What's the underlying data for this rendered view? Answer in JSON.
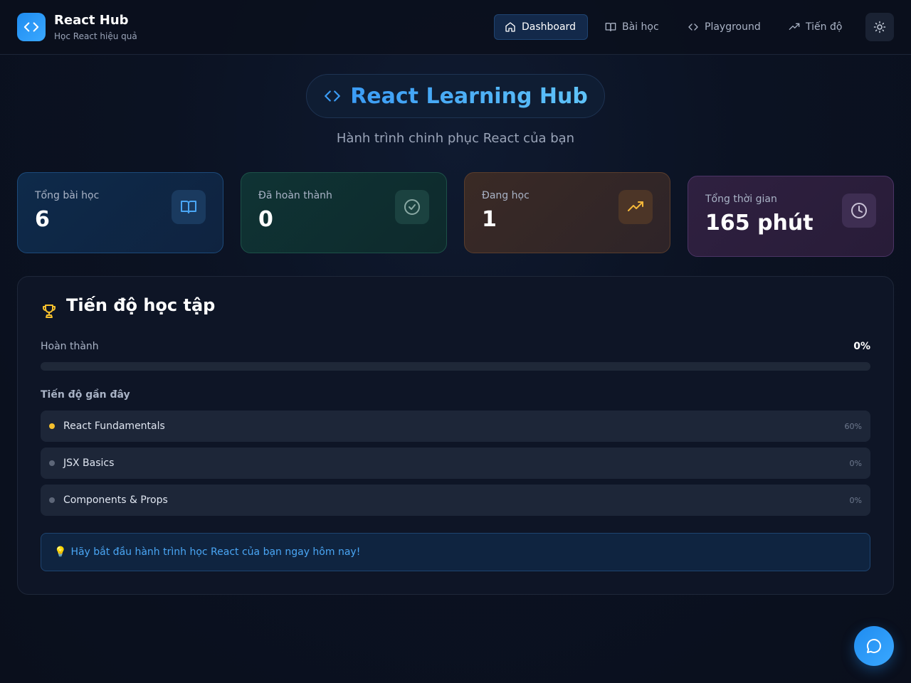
{
  "header": {
    "brand_title": "React Hub",
    "brand_subtitle": "Học React hiệu quả",
    "nav": [
      {
        "label": "Dashboard",
        "icon": "home-icon",
        "active": true
      },
      {
        "label": "Bài học",
        "icon": "book-icon",
        "active": false
      },
      {
        "label": "Playground",
        "icon": "code-icon",
        "active": false
      },
      {
        "label": "Tiến độ",
        "icon": "trending-up-icon",
        "active": false
      }
    ],
    "theme_icon": "sun-icon"
  },
  "hero": {
    "title": "React Learning Hub",
    "subtitle": "Hành trình chinh phục React của bạn"
  },
  "stats": [
    {
      "label": "Tổng bài học",
      "value": "6",
      "icon": "book-icon",
      "color": "#4aa6f4"
    },
    {
      "label": "Đã hoàn thành",
      "value": "0",
      "icon": "check-circle-icon",
      "color": "#8aa9a4"
    },
    {
      "label": "Đang học",
      "value": "1",
      "icon": "trending-up-icon",
      "color": "#f5b83a"
    },
    {
      "label": "Tổng thời gian",
      "value": "165 phút",
      "icon": "clock-icon",
      "color": "#c9c2d6"
    }
  ],
  "progress": {
    "title": "Tiến độ học tập",
    "complete_label": "Hoàn thành",
    "complete_percent": "0%",
    "complete_fraction": 0,
    "recent_title": "Tiến độ gần đây",
    "items": [
      {
        "name": "React Fundamentals",
        "percent": "60%",
        "dot_color": "#f5c02e"
      },
      {
        "name": "JSX Basics",
        "percent": "0%",
        "dot_color": "#5d6678"
      },
      {
        "name": "Components & Props",
        "percent": "0%",
        "dot_color": "#5d6678"
      }
    ],
    "tip": "Hãy bắt đầu hành trình học React của bạn ngay hôm nay!",
    "tip_icon": "lightbulb-icon"
  },
  "chat_icon": "chat-bubble-icon"
}
